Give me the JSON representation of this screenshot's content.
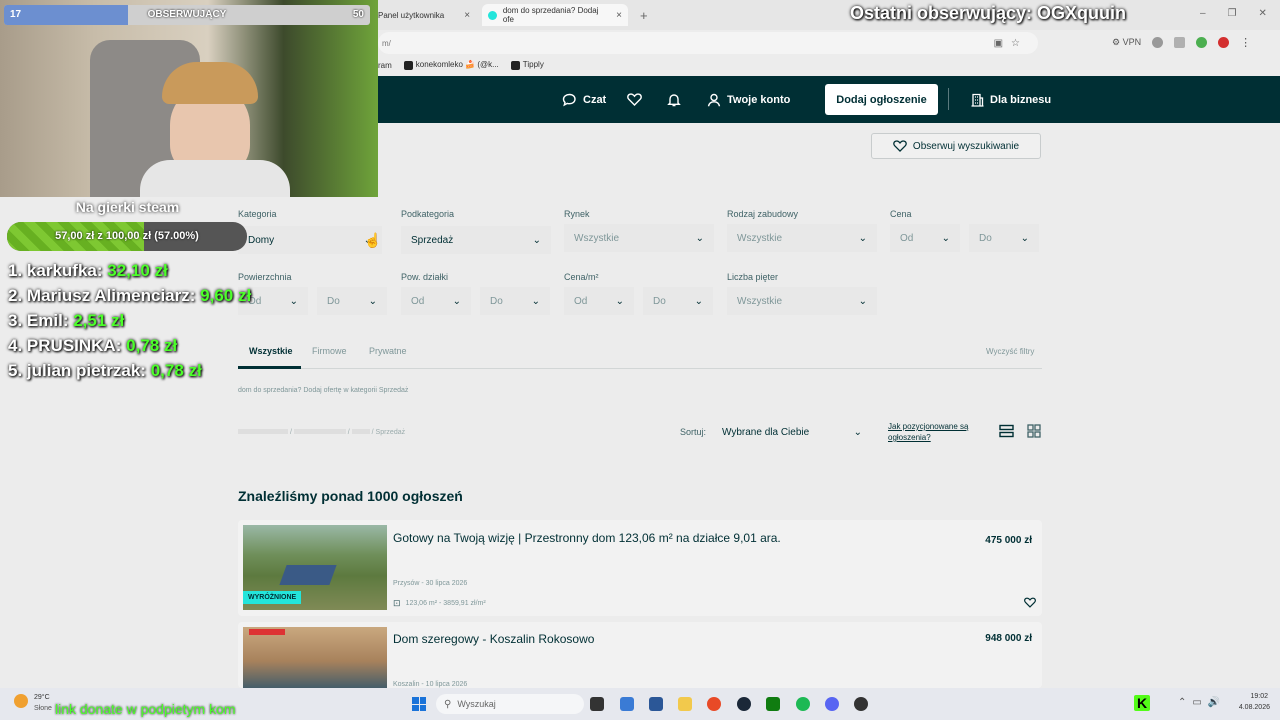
{
  "browser": {
    "tabs": [
      {
        "label": "Panel użytkownika"
      },
      {
        "label": "dom do sprzedania? Dodaj ofe"
      }
    ],
    "address": "m/",
    "bookmarks": [
      "ram",
      "konekomleko 🍰 (@k...",
      "Tipply"
    ],
    "vpn_label": "VPN"
  },
  "header": {
    "chat": "Czat",
    "account": "Twoje konto",
    "post_ad": "Dodaj ogłoszenie",
    "business": "Dla biznesu"
  },
  "follow_search": "Obserwuj wyszukiwanie",
  "filters": {
    "row1": [
      {
        "label": "Kategoria",
        "value": "Domy"
      },
      {
        "label": "Podkategoria",
        "value": "Sprzedaż"
      },
      {
        "label": "Rynek",
        "value": "Wszystkie"
      },
      {
        "label": "Rodzaj zabudowy",
        "value": "Wszystkie"
      },
      {
        "label": "Cena",
        "from": "Od",
        "to": "Do"
      }
    ],
    "row2": [
      {
        "label": "Powierzchnia",
        "from": "Od",
        "to": "Do"
      },
      {
        "label": "Pow. działki",
        "from": "Od",
        "to": "Do"
      },
      {
        "label": "Cena/m²",
        "from": "Od",
        "to": "Do"
      },
      {
        "label": "Liczba pięter",
        "value": "Wszystkie"
      }
    ]
  },
  "seller_tabs": [
    "Wszystkie",
    "Firmowe",
    "Prywatne"
  ],
  "clear_filters": "Wyczyść filtry",
  "promo_text": "dom do sprzedania? Dodaj ofertę w kategorii Sprzedaż",
  "breadcrumb_last": "/ Sprzedaż",
  "sort": {
    "label": "Sortuj:",
    "value": "Wybrane dla Ciebie"
  },
  "positioning_link": [
    "Jak pozycjonowane są",
    "ogłoszenia?"
  ],
  "results_heading": "Znaleźliśmy ponad 1000 ogłoszeń",
  "listings": [
    {
      "title": "Gotowy na Twoją wizję | Przestronny dom 123,06 m² na działce 9,01 ara.",
      "price": "475 000 zł",
      "location": "Przysów - 30 lipca 2026",
      "meta": "123,06 m² - 3859,91 zł/m²",
      "badge": "WYRÓŻNIONE"
    },
    {
      "title": "Dom szeregowy - Koszalin Rokosowo",
      "price": "948 000 zł",
      "location": "Koszalin - 10 lipca 2026"
    }
  ],
  "overlay": {
    "followers_label": "OBSERWUJĄCY",
    "followers_current": "17",
    "followers_goal": "50",
    "followers_progress": 0.34,
    "last_follower": "Ostatni obserwujący: OGXquuin",
    "goal_title": "Na gierki steam",
    "goal_text": "57,00 zł z 100,00 zł (57.00%)",
    "goal_progress": 0.57,
    "donors": [
      {
        "rank": "1.",
        "name": "karkufka:",
        "amount": "32,10 zł"
      },
      {
        "rank": "2.",
        "name": "Mariusz Alimenciarz:",
        "amount": "9,60 zł"
      },
      {
        "rank": "3.",
        "name": "Emil:",
        "amount": "2,51 zł"
      },
      {
        "rank": "4.",
        "name": "PRUSINKA:",
        "amount": "0,78 zł"
      },
      {
        "rank": "5.",
        "name": "julian pietrzak:",
        "amount": "0,78 zł"
      }
    ],
    "donate_link_text": "link donate w podpietym kom"
  },
  "taskbar": {
    "weather_temp": "29°C",
    "weather_desc": "Słone",
    "search_placeholder": "Wyszukaj",
    "time": "19:02",
    "date": "4.08.2026"
  },
  "colors": {
    "brand_dark": "#002f34",
    "goal_green": "#7ec832",
    "donor_amount": "#4cff2a"
  }
}
